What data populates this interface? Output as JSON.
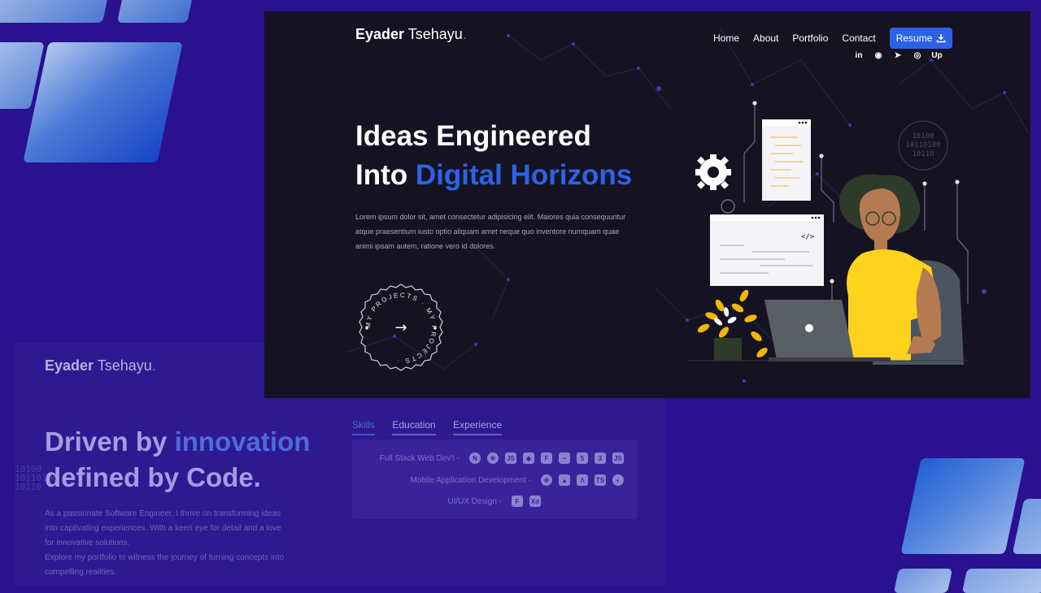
{
  "colors": {
    "accent": "#2b62e8",
    "background": "#2a1190",
    "panel": "#151322"
  },
  "main": {
    "logo_first": "Eyader",
    "logo_last": "Tsehayu",
    "logo_dot": ".",
    "nav": [
      "Home",
      "About",
      "Portfolio",
      "Contact"
    ],
    "resume_label": "Resume",
    "social": [
      {
        "icon": "linkedin-icon",
        "glyph": "in"
      },
      {
        "icon": "github-icon",
        "glyph": "◉"
      },
      {
        "icon": "telegram-icon",
        "glyph": "➤"
      },
      {
        "icon": "instagram-icon",
        "glyph": "◎"
      },
      {
        "icon": "upwork-icon",
        "glyph": "Up"
      }
    ],
    "heading_line1": "Ideas Engineered",
    "heading_line2_plain": "Into ",
    "heading_line2_highlight": "Digital Horizons",
    "paragraph": "Lorem ipsum dolor sit, amet consectetur adipisicing elit. Maiores quia consequuntur atque praesentium iusto optio aliquam amet neque quo inventore numquam quae animi ipsam autem, ratione vero id dolores.",
    "badge_text": "MY PROJECTS · MY PROJECTS ·",
    "badge_arrow": "→",
    "illustration_code_tag": "</>",
    "illustration_binary": [
      "10100",
      "10110100",
      "10110"
    ]
  },
  "secondary": {
    "logo_first": "Eyader",
    "logo_last": "Tsehayu",
    "logo_dot": ".",
    "heading_line1_plain": "Driven by ",
    "heading_line1_highlight": "innovation",
    "heading_line2": "defined by Code.",
    "paragraph1": "As a passionate Software Engineer, I thrive on transforming ideas into captivating experiences. With a keen eye for detail and a love for innovative solutions.",
    "paragraph2": "Explore my portfolio to witness the journey of turning concepts into compelling realities.",
    "deco_binary": [
      "10100",
      "10110100",
      "10110"
    ],
    "tabs": [
      "Skills",
      "Education",
      "Experience"
    ],
    "active_tab": "Skills",
    "skills": [
      {
        "label": "Full Stack Web Dev't",
        "icons": [
          "N",
          "⚛",
          "JS",
          "◆",
          "F",
          "~",
          "5",
          "3",
          "JS"
        ]
      },
      {
        "label": "Mobile Application Development",
        "icons": [
          "⚛",
          "▲",
          "Λ",
          "TS",
          "◐"
        ]
      },
      {
        "label": "UI/UX Design",
        "icons": [
          "F",
          "Xd"
        ]
      }
    ]
  }
}
